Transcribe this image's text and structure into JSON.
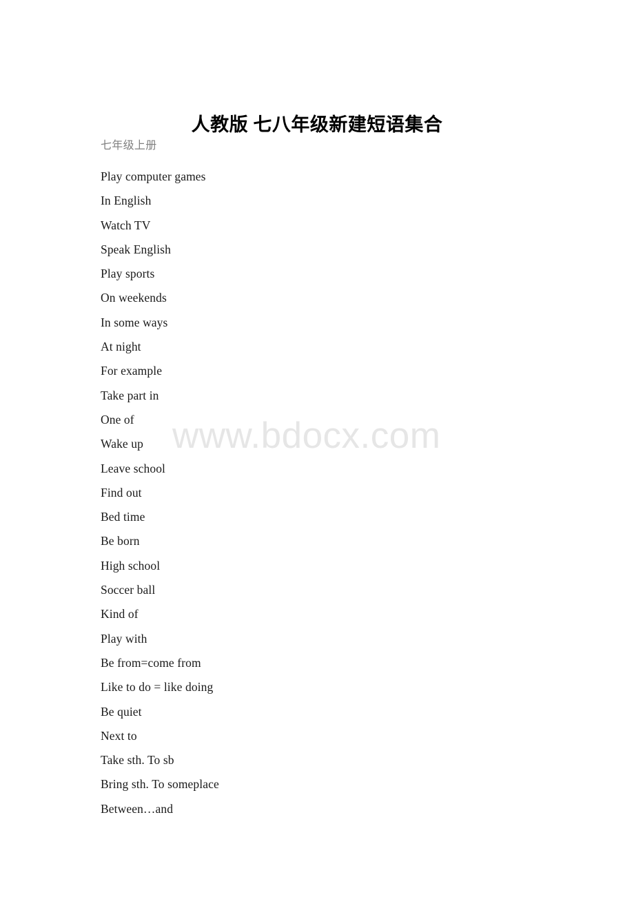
{
  "document": {
    "title": "人教版 七八年级新建短语集合",
    "subtitle": "七年级上册",
    "watermark": "www.bdocx.com",
    "colors": {
      "page_background": "#ffffff",
      "title_text": "#000000",
      "subtitle_text": "#808080",
      "body_text": "#1a1a1a",
      "watermark_text": "#e6e6e6"
    },
    "phrases": [
      "Play computer games",
      "In English",
      "Watch TV",
      "Speak English",
      "Play sports",
      "On weekends",
      "In some ways",
      "At night",
      "For example",
      "Take part in",
      "One of",
      "Wake up",
      "Leave school",
      "Find out",
      "Bed time",
      "Be born",
      "High school",
      "Soccer ball",
      "Kind of",
      "Play with",
      "Be from=come from",
      "Like to do = like doing",
      "Be quiet",
      "Next to",
      "Take sth. To sb",
      "Bring sth. To someplace",
      "Between…and"
    ]
  }
}
